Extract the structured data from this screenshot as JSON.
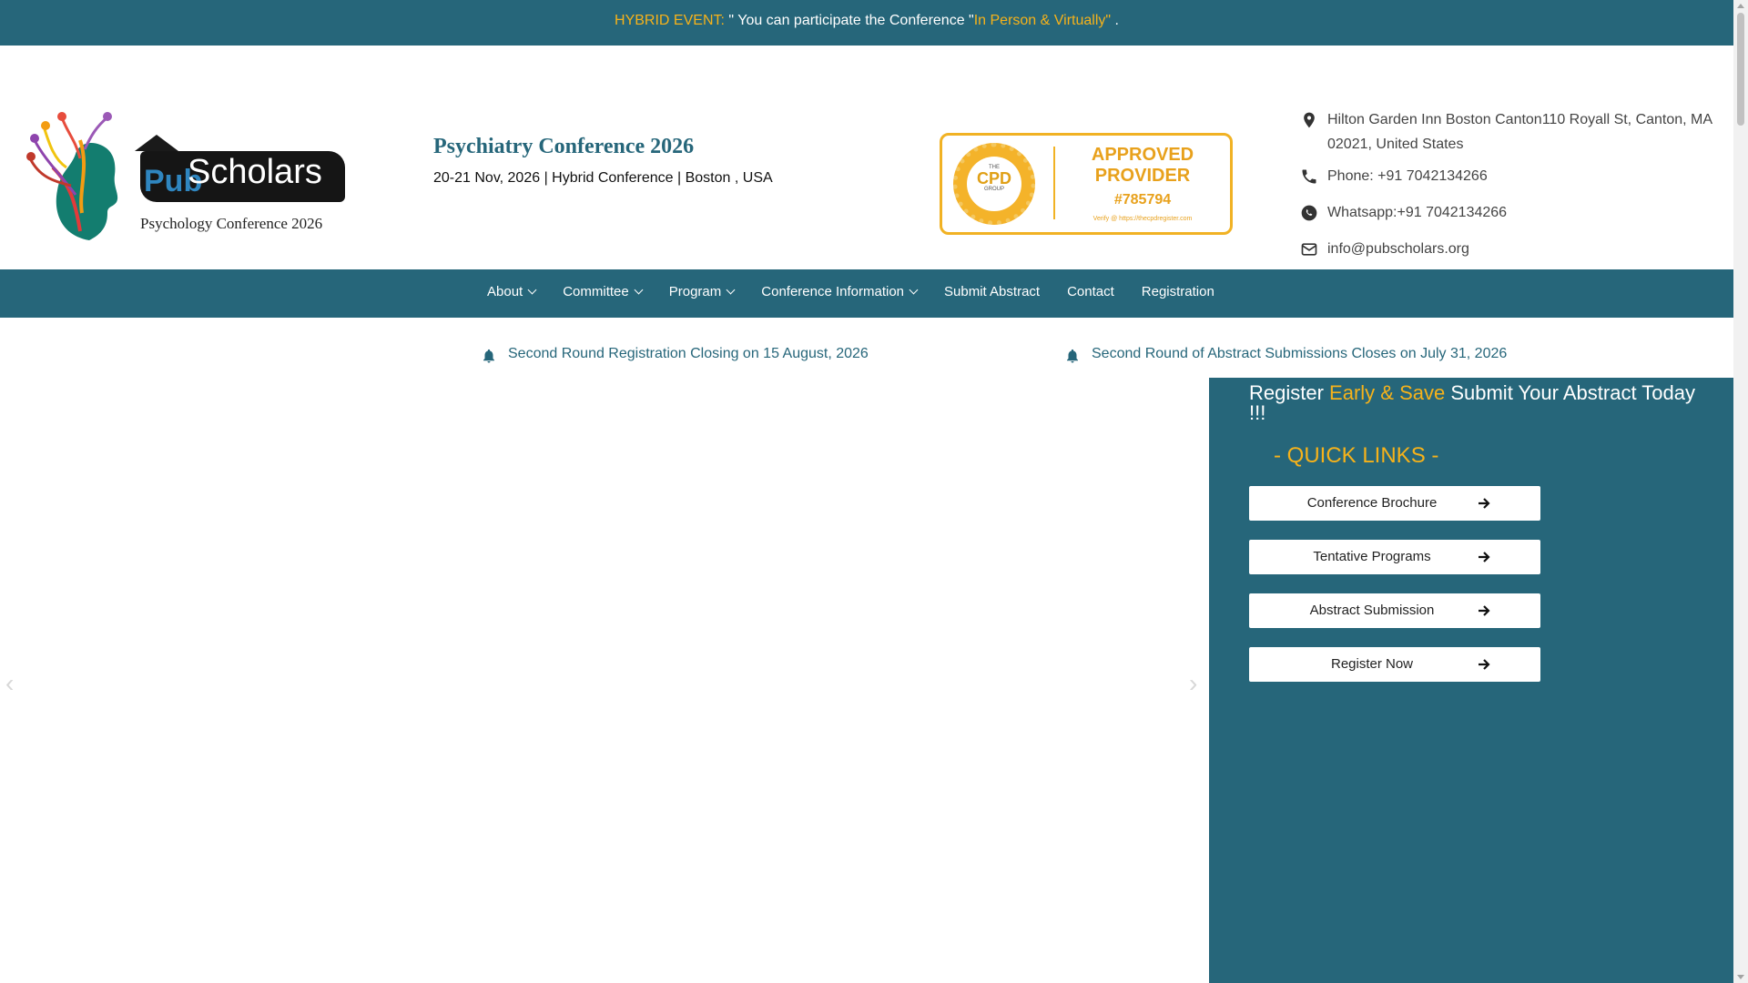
{
  "topbar": {
    "label": "HYBRID EVENT:",
    "text_before": " \" You can participate the Conference \"",
    "highlight": "In Person & Virtually\"",
    "text_after": " ."
  },
  "logo": {
    "brand_pub": "Pub",
    "brand_scholars": "Scholars",
    "tagline": "Psychology Conference 2026"
  },
  "conference": {
    "title": "Psychiatry Conference 2026",
    "subtitle": "20-21 Nov, 2026 | Hybrid Conference | Boston , USA"
  },
  "cpd_badge": {
    "seal_top": "THE",
    "seal_mid": "CPD",
    "seal_bot": "GROUP",
    "approved": "APPROVED PROVIDER",
    "number": "#785794",
    "verify": "Verify @ https://thecpdregister.com"
  },
  "contact": {
    "address": "Hilton Garden Inn Boston Canton110 Royall St, Canton, MA 02021, United States",
    "phone": "Phone: +91 7042134266",
    "whatsapp": "Whatsapp:+91 7042134266",
    "email": "info@pubscholars.org"
  },
  "nav": {
    "items": [
      {
        "label": "About",
        "dropdown": true
      },
      {
        "label": "Committee",
        "dropdown": true
      },
      {
        "label": "Program",
        "dropdown": true
      },
      {
        "label": "Conference Information",
        "dropdown": true
      },
      {
        "label": "Submit Abstract",
        "dropdown": false
      },
      {
        "label": "Contact",
        "dropdown": false
      },
      {
        "label": "Registration",
        "dropdown": false
      }
    ]
  },
  "notices": {
    "registration": "Second Round Registration Closing on 15 August, 2026",
    "abstract": "Second Round of Abstract Submissions Closes on July 31, 2026"
  },
  "slider": {
    "prev_icon": "chevron-left-icon",
    "next_icon": "chevron-right-icon"
  },
  "sidebar": {
    "headline_start": "Register ",
    "headline_highlight": "Early & Save",
    "headline_end": " Submit Your Abstract Today !!!",
    "quick_links_title": "- QUICK LINKS -",
    "buttons": [
      {
        "label": "Conference Brochure"
      },
      {
        "label": "Tentative Programs"
      },
      {
        "label": "Abstract Submission"
      },
      {
        "label": "Register Now"
      }
    ]
  },
  "colors": {
    "primary": "#26667a",
    "accent": "#f6b21a",
    "white": "#ffffff"
  }
}
